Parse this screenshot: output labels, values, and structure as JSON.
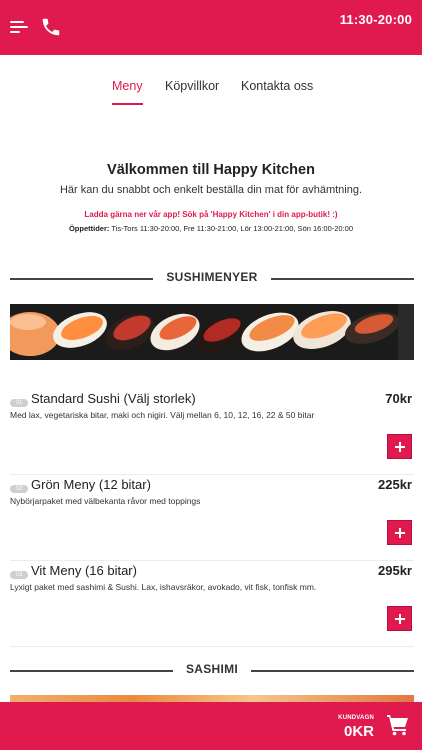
{
  "header": {
    "hours": "11:30-20:00",
    "menu_icon": "hamburger-menu-icon",
    "phone_icon": "phone-icon",
    "color": "#e0194f"
  },
  "tabs": [
    {
      "label": "Meny",
      "active": true
    },
    {
      "label": "Köpvillkor",
      "active": false
    },
    {
      "label": "Kontakta oss",
      "active": false
    }
  ],
  "welcome": {
    "title": "Välkommen till Happy Kitchen",
    "subtitle": "Här kan du snabbt och enkelt beställa din mat för avhämtning.",
    "promo": "Ladda gärna ner vår app! Sök på 'Happy Kitchen' i din app-butik! :)",
    "opening_label": "Öppettider:",
    "opening_text": "Tis-Tors 11:30-20:00, Fre 11:30-21:00, Lör 13:00-21:00, Sön 16:00-20:00"
  },
  "sections": [
    {
      "title": "SUSHIMENYER",
      "items": [
        {
          "num": "01",
          "name": "Standard Sushi (Välj storlek)",
          "price": "70kr",
          "desc": "Med lax, vegetariska bitar, maki och nigiri. Välj mellan 6, 10, 12, 16, 22 & 50 bitar"
        },
        {
          "num": "02",
          "name": "Grön Meny (12 bitar)",
          "price": "225kr",
          "desc": "Nybörjarpaket med välbekanta råvor med toppings"
        },
        {
          "num": "03",
          "name": "Vit Meny (16 bitar)",
          "price": "295kr",
          "desc": "Lyxigt paket med sashimi & Sushi. Lax, ishavsräkor, avokado, vit fisk, tonfisk mm."
        }
      ]
    },
    {
      "title": "SASHIMI",
      "items": []
    }
  ],
  "cart": {
    "label": "KUNDVAGN",
    "total": "0KR",
    "icon": "shopping-cart-icon"
  }
}
